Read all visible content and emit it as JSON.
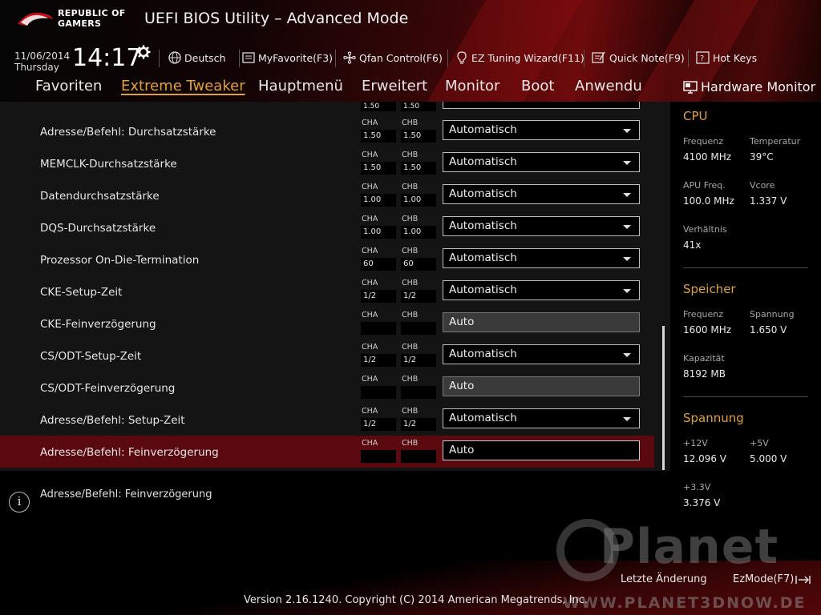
{
  "header": {
    "brand_line1": "REPUBLIC OF",
    "brand_line2": "GAMERS",
    "title": "UEFI BIOS Utility – Advanced Mode",
    "date": "11/06/2014",
    "day": "Thursday",
    "time": "14:17"
  },
  "toolbar": [
    {
      "label": "Deutsch",
      "icon": "globe-icon"
    },
    {
      "label": "MyFavorite(F3)",
      "icon": "favorite-icon"
    },
    {
      "label": "Qfan Control(F6)",
      "icon": "fan-icon"
    },
    {
      "label": "EZ Tuning Wizard(F11)",
      "icon": "lightbulb-icon"
    },
    {
      "label": "Quick Note(F9)",
      "icon": "note-icon"
    },
    {
      "label": "Hot Keys",
      "icon": "hotkeys-icon"
    }
  ],
  "nav": [
    {
      "label": "Favoriten",
      "active": false
    },
    {
      "label": "Extreme Tweaker",
      "active": true
    },
    {
      "label": "Hauptmenü",
      "active": false
    },
    {
      "label": "Erweitert",
      "active": false
    },
    {
      "label": "Monitor",
      "active": false
    },
    {
      "label": "Boot",
      "active": false
    },
    {
      "label": "Anwendu",
      "active": false
    }
  ],
  "partial_row": {
    "cha": "1.50",
    "chb": "1.50"
  },
  "rows": [
    {
      "label": "Adresse/Befehl: Durchsatzstärke",
      "cha_label": "CHA",
      "chb_label": "CHB",
      "cha": "1.50",
      "chb": "1.50",
      "value": "Automatisch",
      "dropdown": true
    },
    {
      "label": "MEMCLK-Durchsatzstärke",
      "cha_label": "CHA",
      "chb_label": "CHB",
      "cha": "1.50",
      "chb": "1.50",
      "value": "Automatisch",
      "dropdown": true
    },
    {
      "label": "Datendurchsatzstärke",
      "cha_label": "CHA",
      "chb_label": "CHB",
      "cha": "1.00",
      "chb": "1.00",
      "value": "Automatisch",
      "dropdown": true
    },
    {
      "label": "DQS-Durchsatzstärke",
      "cha_label": "CHA",
      "chb_label": "CHB",
      "cha": "1.00",
      "chb": "1.00",
      "value": "Automatisch",
      "dropdown": true
    },
    {
      "label": "Prozessor On-Die-Termination",
      "cha_label": "CHA",
      "chb_label": "CHB",
      "cha": "60",
      "chb": "60",
      "value": "Automatisch",
      "dropdown": true
    },
    {
      "label": "CKE-Setup-Zeit",
      "cha_label": "CHA",
      "chb_label": "CHB",
      "cha": "1/2",
      "chb": "1/2",
      "value": "Automatisch",
      "dropdown": true
    },
    {
      "label": "CKE-Feinverzögerung",
      "cha_label": "CHA",
      "chb_label": "CHB",
      "cha": "",
      "chb": "",
      "value": "Auto",
      "dropdown": false
    },
    {
      "label": "CS/ODT-Setup-Zeit",
      "cha_label": "CHA",
      "chb_label": "CHB",
      "cha": "1/2",
      "chb": "1/2",
      "value": "Automatisch",
      "dropdown": true
    },
    {
      "label": "CS/ODT-Feinverzögerung",
      "cha_label": "CHA",
      "chb_label": "CHB",
      "cha": "",
      "chb": "",
      "value": "Auto",
      "dropdown": false
    },
    {
      "label": "Adresse/Befehl: Setup-Zeit",
      "cha_label": "CHA",
      "chb_label": "CHB",
      "cha": "1/2",
      "chb": "1/2",
      "value": "Automatisch",
      "dropdown": true
    },
    {
      "label": "Adresse/Befehl: Feinverzögerung",
      "cha_label": "CHA",
      "chb_label": "CHB",
      "cha": "",
      "chb": "",
      "value": "Auto",
      "dropdown": false,
      "selected": true
    }
  ],
  "help": {
    "text": "Adresse/Befehl: Feinverzögerung",
    "icon_glyph": "i"
  },
  "hardware_monitor": {
    "title": "Hardware Monitor",
    "cpu": {
      "title": "CPU",
      "freq_label": "Frequenz",
      "freq": "4100 MHz",
      "temp_label": "Temperatur",
      "temp": "39°C",
      "apu_label": "APU Freq.",
      "apu": "100.0 MHz",
      "vcore_label": "Vcore",
      "vcore": "1.337 V",
      "ratio_label": "Verhältnis",
      "ratio": "41x"
    },
    "memory": {
      "title": "Speicher",
      "freq_label": "Frequenz",
      "freq": "1600 MHz",
      "volt_label": "Spannung",
      "volt": "1.650 V",
      "cap_label": "Kapazität",
      "cap": "8192 MB"
    },
    "voltage": {
      "title": "Spannung",
      "v12_label": "+12V",
      "v12": "12.096 V",
      "v5_label": "+5V",
      "v5": "5.000 V",
      "v33_label": "+3.3V",
      "v33": "3.376 V"
    }
  },
  "footer": {
    "last_change": "Letzte Änderung",
    "ezmode": "EzMode(F7)",
    "version": "Version 2.16.1240. Copyright (C) 2014 American Megatrends, Inc.",
    "watermark": "Planet",
    "watermark_sub": "3DNOW.DE",
    "watermark_full": "WWW.PLANET3DNOW.DE"
  },
  "colors": {
    "accent": "#e0a040",
    "selected_row": "#5a0a0f",
    "brand_red": "#6e0a0c"
  }
}
